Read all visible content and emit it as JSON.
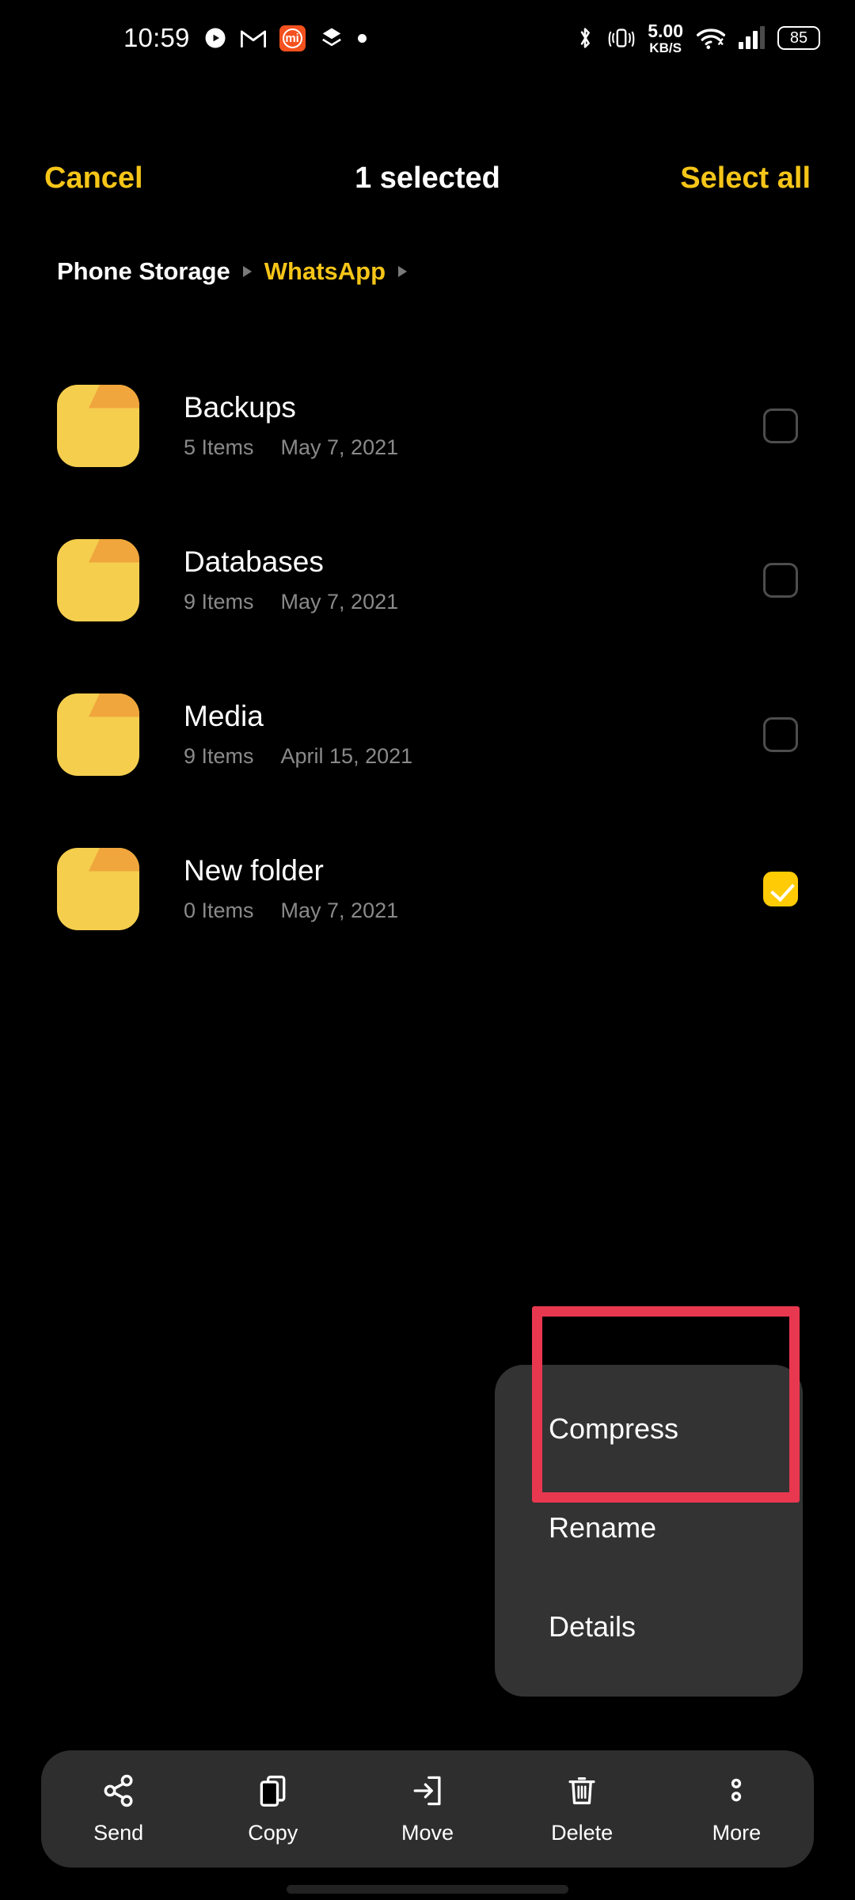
{
  "status_bar": {
    "clock": "10:59",
    "left_icons": [
      {
        "name": "media-notification-icon",
        "glyph": "◔"
      },
      {
        "name": "gmail-icon",
        "glyph": "M"
      },
      {
        "name": "mi-app-icon",
        "glyph": "mi"
      },
      {
        "name": "layers-notification-icon",
        "glyph": "◆"
      },
      {
        "name": "dot-notification-icon",
        "glyph": "•"
      }
    ],
    "bluetooth_icon": "bluetooth-icon",
    "vibrate_icon": "vibrate-icon",
    "network_speed_value": "5.00",
    "network_speed_unit": "KB/S",
    "wifi_icon": "wifi-icon",
    "signal_icon": "cellular-signal-icon",
    "battery_level": "85"
  },
  "app_bar": {
    "cancel_label": "Cancel",
    "title": "1 selected",
    "select_all_label": "Select all",
    "accent_color": "#F5C518"
  },
  "breadcrumb": {
    "items": [
      {
        "label": "Phone Storage",
        "current": false
      },
      {
        "label": "WhatsApp",
        "current": true
      }
    ]
  },
  "file_list": {
    "rows": [
      {
        "name": "Backups",
        "items": "5 Items",
        "date": "May 7, 2021",
        "selected": false
      },
      {
        "name": "Databases",
        "items": "9 Items",
        "date": "May 7, 2021",
        "selected": false
      },
      {
        "name": "Media",
        "items": "9 Items",
        "date": "April 15, 2021",
        "selected": false
      },
      {
        "name": "New folder",
        "items": "0 Items",
        "date": "May 7, 2021",
        "selected": true
      }
    ]
  },
  "popup_menu": {
    "items": [
      {
        "label": "Compress",
        "highlighted": true
      },
      {
        "label": "Rename",
        "highlighted": false
      },
      {
        "label": "Details",
        "highlighted": false
      }
    ],
    "background_color": "#333333"
  },
  "annotation": {
    "target": "Compress",
    "color": "#E8384F"
  },
  "bottom_toolbar": {
    "items": [
      {
        "label": "Send",
        "icon": "share-icon"
      },
      {
        "label": "Copy",
        "icon": "copy-icon"
      },
      {
        "label": "Move",
        "icon": "move-icon"
      },
      {
        "label": "Delete",
        "icon": "trash-icon"
      },
      {
        "label": "More",
        "icon": "more-vertical-icon"
      }
    ],
    "background_color": "#2E2E2E"
  },
  "theme": {
    "background": "#000000",
    "folder_yellow": "#F5CE4E",
    "folder_tab_orange": "#F0A63C",
    "checkbox_checked": "#FFCB05",
    "muted_text": "#8A8A8A"
  }
}
